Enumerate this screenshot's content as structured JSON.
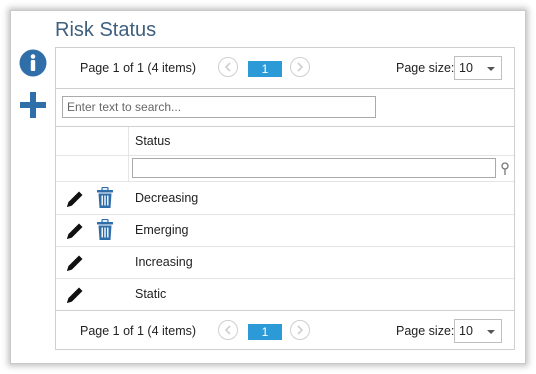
{
  "title": "Risk Status",
  "pager": {
    "info": "Page 1 of 1 (4 items)",
    "current_page": "1",
    "page_size_label": "Page size:",
    "page_size_value": "10"
  },
  "search": {
    "placeholder": "Enter text to search..."
  },
  "grid": {
    "column_header": "Status",
    "rows": [
      {
        "status": "Decreasing",
        "deletable": true
      },
      {
        "status": "Emerging",
        "deletable": true
      },
      {
        "status": "Increasing",
        "deletable": false
      },
      {
        "status": "Static",
        "deletable": false
      }
    ]
  },
  "icons": {
    "info": "info-icon",
    "add": "plus-icon",
    "edit": "pencil-icon",
    "delete": "trash-icon",
    "filter": "pin-icon"
  },
  "colors": {
    "accent": "#2b9ad6",
    "side_icon": "#2f6ea9",
    "title": "#3e5f7d"
  }
}
